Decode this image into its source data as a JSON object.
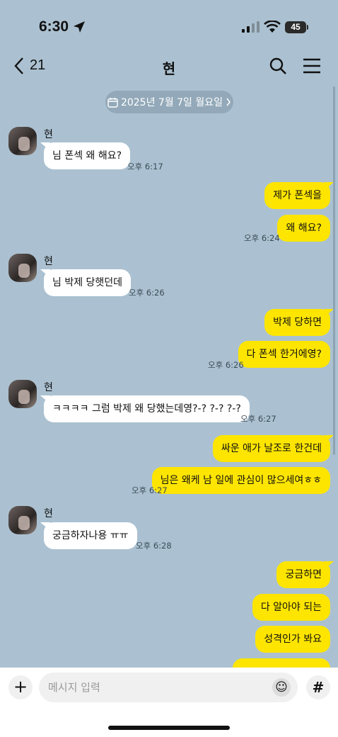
{
  "status": {
    "time": "6:30",
    "battery": "45"
  },
  "header": {
    "back_count": "21",
    "title": "현"
  },
  "date_divider": "2025년 7월 7일 월요일",
  "chat": {
    "sender_name": "현",
    "messages": [
      {
        "dir": "in",
        "text": "님 폰섹 왜 해요?",
        "time": "오후 6:17"
      },
      {
        "dir": "out",
        "text": "제가 폰섹을"
      },
      {
        "dir": "out",
        "text": "왜 해요?",
        "time": "오후 6:24"
      },
      {
        "dir": "in",
        "text": "님 박제 당햇던데",
        "time": "오후 6:26"
      },
      {
        "dir": "out",
        "text": "박제 당하면"
      },
      {
        "dir": "out",
        "text": "다 폰섹 한거에영?",
        "time": "오후 6:26"
      },
      {
        "dir": "in",
        "text": "ㅋㅋㅋㅋ 그럼 박제 왜 당했는데영?-? ?-? ?-?",
        "time": "오후 6:27"
      },
      {
        "dir": "out",
        "text": "싸운 애가 날조로 한건데"
      },
      {
        "dir": "out",
        "text": "님은 왜케 남 일에 관심이 많으세여ㅎㅎ",
        "time": "오후 6:27"
      },
      {
        "dir": "in",
        "text": "궁금하자나용 ㅠㅠ",
        "time": "오후 6:28"
      },
      {
        "dir": "out",
        "text": "궁금하면"
      },
      {
        "dir": "out",
        "text": "다 알아야 되는"
      },
      {
        "dir": "out",
        "text": "성격인가 봐요"
      }
    ]
  },
  "composer": {
    "placeholder": "메시지 입력"
  },
  "colors": {
    "background": "#abc1d1",
    "outgoing_bubble": "#fde500",
    "incoming_bubble": "#ffffff"
  }
}
